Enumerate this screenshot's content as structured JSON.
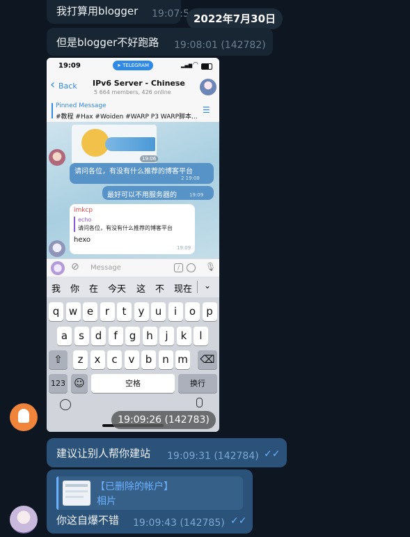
{
  "date_chip": "2022年7月30日",
  "messages": [
    {
      "text": "我打算用blogger",
      "time": "19:07:5"
    },
    {
      "text": "但是blogger不好跑路",
      "time": "19:08:01 (142782)"
    },
    {
      "image_time": "19:09:26 (142783)"
    },
    {
      "text": "建议让别人帮你建站",
      "time": "19:09:31 (142784)"
    },
    {
      "reply_name": "【已删除的帐户】",
      "reply_type": "相片",
      "text": "你这自爆不错",
      "time": "19:09:43 (142785)"
    }
  ],
  "screenshot": {
    "status_time": "19:09",
    "status_badge": "TELEGRAM",
    "back_label": "Back",
    "chat_title": "IPv6 Server - Chinese",
    "chat_sub": "5 664 members, 426 online",
    "pinned_label": "Pinned Message",
    "pinned_text": "#教程 #Hax #Woiden #WARP P3 WARP脚本...",
    "sticker_time": "19:06",
    "b1_text": "请问各位，有没有什么推荐的博客平台",
    "b1_meta": "2  19:08",
    "b2_text": "最好可以不用服务器的",
    "b2_time": "19:09",
    "r_name": "imkcp",
    "r_quote_name": "echo",
    "r_quote_text": "请问各位，有没有什么推荐的博客平台",
    "r_text": "hexo",
    "r_time": "19:09",
    "input_placeholder": "Message",
    "candidates": [
      "我",
      "你",
      "在",
      "今天",
      "这",
      "不",
      "现在"
    ],
    "row1": [
      "q",
      "w",
      "e",
      "r",
      "t",
      "y",
      "u",
      "i",
      "o",
      "p"
    ],
    "row2": [
      "a",
      "s",
      "d",
      "f",
      "g",
      "h",
      "j",
      "k",
      "l"
    ],
    "row3": [
      "z",
      "x",
      "c",
      "v",
      "b",
      "n",
      "m"
    ],
    "key_123": "123",
    "key_space": "空格",
    "key_return": "换行"
  },
  "colors": {
    "bg": "#0e1621",
    "incoming": "#182533",
    "outgoing": "#2b5278",
    "accent": "#5793c7"
  }
}
